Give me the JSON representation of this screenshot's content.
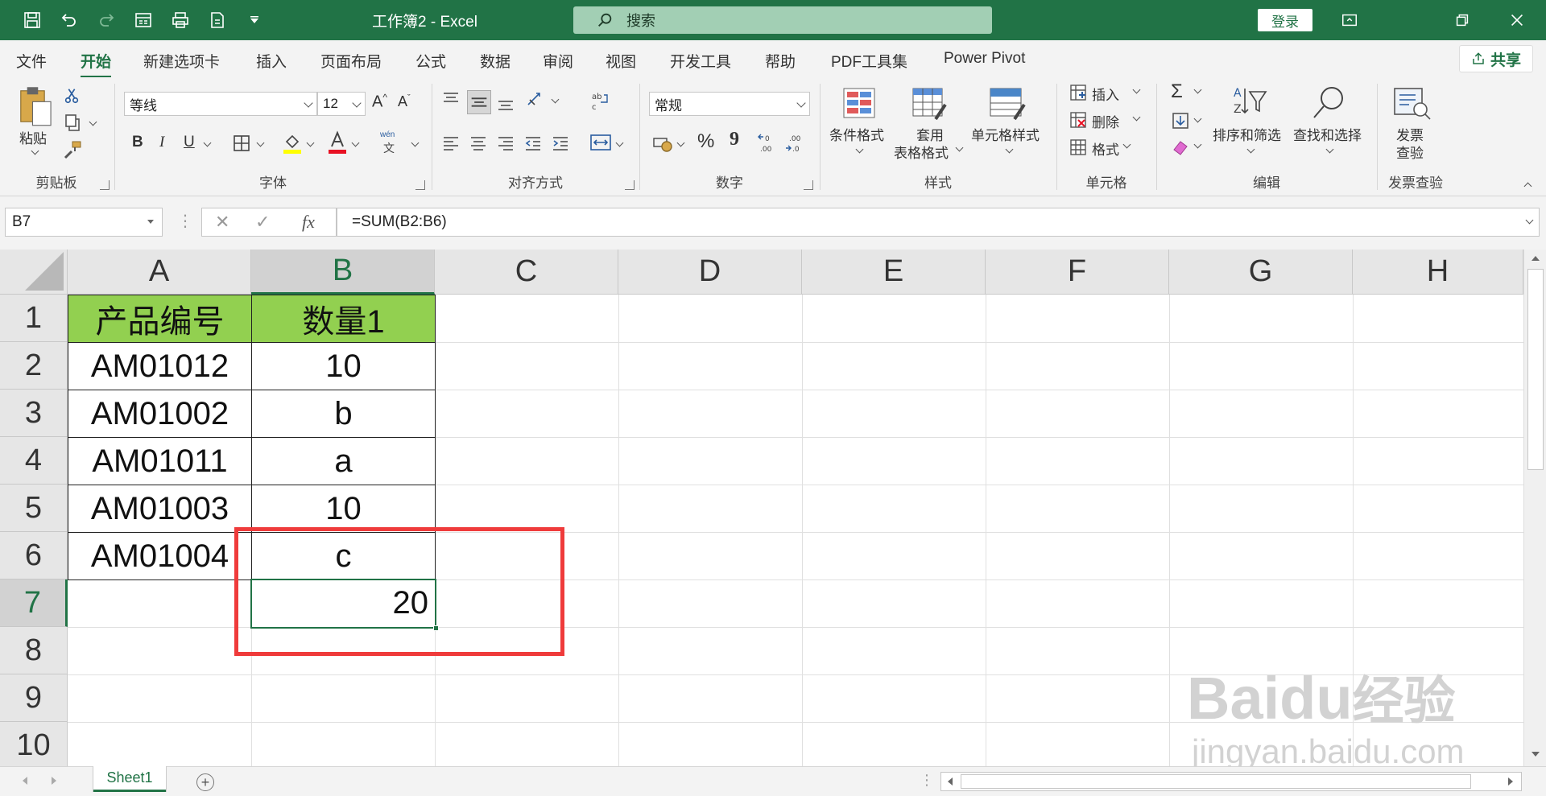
{
  "window": {
    "title": "工作簿2  -  Excel",
    "search_placeholder": "搜索",
    "login_label": "登录"
  },
  "menu": {
    "tabs": [
      "文件",
      "开始",
      "新建选项卡",
      "插入",
      "页面布局",
      "公式",
      "数据",
      "审阅",
      "视图",
      "开发工具",
      "帮助",
      "PDF工具集",
      "Power Pivot"
    ],
    "active_tab": "开始",
    "share_label": "共享"
  },
  "ribbon": {
    "clipboard": {
      "paste_label": "粘贴",
      "group_label": "剪贴板"
    },
    "font": {
      "font_name": "等线",
      "font_size": "12",
      "bold": "B",
      "italic": "I",
      "underline": "U",
      "font_color_letter": "A",
      "wen_top": "wén",
      "wen_bottom": "文",
      "group_label": "字体"
    },
    "alignment": {
      "group_label": "对齐方式"
    },
    "number": {
      "format": "常规",
      "percent": "%",
      "comma": "9",
      "group_label": "数字"
    },
    "styles": {
      "conditional_label": "条件格式",
      "table_label_1": "套用",
      "table_label_2": "表格格式",
      "cell_style_label": "单元格样式",
      "group_label": "样式"
    },
    "cells": {
      "insert_label": "插入",
      "delete_label": "删除",
      "format_label": "格式",
      "group_label": "单元格"
    },
    "editing": {
      "sort_label": "排序和筛选",
      "find_label": "查找和选择",
      "group_label": "编辑"
    },
    "invoice": {
      "label_1": "发票",
      "label_2": "查验",
      "group_label": "发票查验"
    }
  },
  "formula_bar": {
    "name_box": "B7",
    "formula": "=SUM(B2:B6)",
    "cancel": "✕",
    "enter": "✓",
    "fx": "fx"
  },
  "sheet": {
    "columns": [
      "A",
      "B",
      "C",
      "D",
      "E",
      "F",
      "G",
      "H"
    ],
    "rows": [
      "1",
      "2",
      "3",
      "4",
      "5",
      "6",
      "7",
      "8",
      "9",
      "10"
    ],
    "header_a": "产品编号",
    "header_b": "数量1",
    "data": [
      {
        "a": "AM01012",
        "b": "10"
      },
      {
        "a": "AM01002",
        "b": "b"
      },
      {
        "a": "AM01011",
        "b": "a"
      },
      {
        "a": "AM01003",
        "b": "10"
      },
      {
        "a": "AM01004",
        "b": "c"
      }
    ],
    "result": "20",
    "active_cell": "B7"
  },
  "sheet_tabs": {
    "tabs": [
      "Sheet1"
    ],
    "add_label": "+"
  },
  "watermark": {
    "brand": "Baidu",
    "brand_cn": "经验",
    "url": "jingyan.baidu.com"
  },
  "colors": {
    "excel_green": "#217346",
    "header_fill": "#92d050",
    "annotation_red": "#ef3b3b"
  }
}
